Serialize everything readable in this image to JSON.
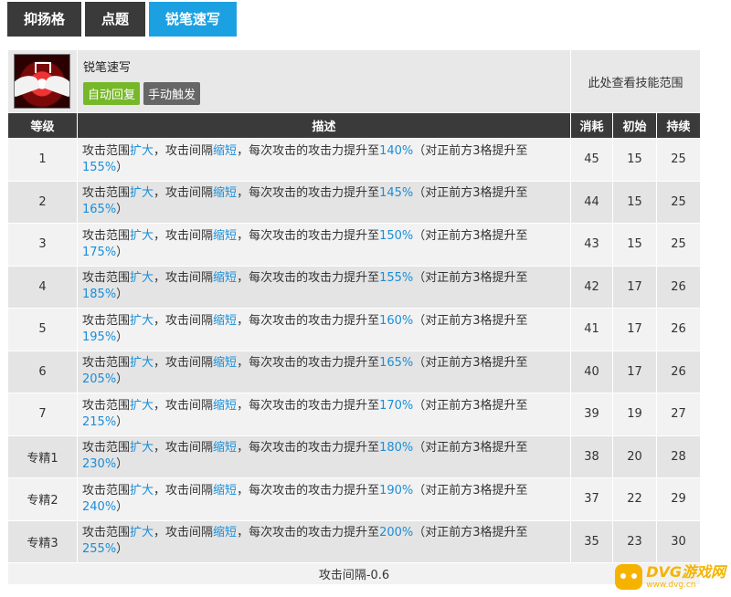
{
  "tabs": [
    {
      "label": "抑扬格",
      "active": false
    },
    {
      "label": "点题",
      "active": false
    },
    {
      "label": "锐笔速写",
      "active": true
    }
  ],
  "skill": {
    "name": "锐笔速写",
    "badges": [
      "自动回复",
      "手动触发"
    ],
    "range_text": "此处查看技能范围",
    "icon": "skill-emblem-icon"
  },
  "columns": [
    "等级",
    "描述",
    "消耗",
    "初始",
    "持续"
  ],
  "rows": [
    {
      "level": "1",
      "p1": "攻击范围",
      "h1": "扩大",
      "p2": "，攻击间隔",
      "h2": "缩短",
      "p3": "，每次攻击的攻击力提升至",
      "h3": "140%",
      "p4": "（对正前方3格提升至",
      "h4": "155%",
      "p5": "）",
      "cost": "45",
      "init": "15",
      "dur": "25"
    },
    {
      "level": "2",
      "p1": "攻击范围",
      "h1": "扩大",
      "p2": "，攻击间隔",
      "h2": "缩短",
      "p3": "，每次攻击的攻击力提升至",
      "h3": "145%",
      "p4": "（对正前方3格提升至",
      "h4": "165%",
      "p5": "）",
      "cost": "44",
      "init": "15",
      "dur": "25"
    },
    {
      "level": "3",
      "p1": "攻击范围",
      "h1": "扩大",
      "p2": "，攻击间隔",
      "h2": "缩短",
      "p3": "，每次攻击的攻击力提升至",
      "h3": "150%",
      "p4": "（对正前方3格提升至",
      "h4": "175%",
      "p5": "）",
      "cost": "43",
      "init": "15",
      "dur": "25"
    },
    {
      "level": "4",
      "p1": "攻击范围",
      "h1": "扩大",
      "p2": "，攻击间隔",
      "h2": "缩短",
      "p3": "，每次攻击的攻击力提升至",
      "h3": "155%",
      "p4": "（对正前方3格提升至",
      "h4": "185%",
      "p5": "）",
      "cost": "42",
      "init": "17",
      "dur": "26"
    },
    {
      "level": "5",
      "p1": "攻击范围",
      "h1": "扩大",
      "p2": "，攻击间隔",
      "h2": "缩短",
      "p3": "，每次攻击的攻击力提升至",
      "h3": "160%",
      "p4": "（对正前方3格提升至",
      "h4": "195%",
      "p5": "）",
      "cost": "41",
      "init": "17",
      "dur": "26"
    },
    {
      "level": "6",
      "p1": "攻击范围",
      "h1": "扩大",
      "p2": "，攻击间隔",
      "h2": "缩短",
      "p3": "，每次攻击的攻击力提升至",
      "h3": "165%",
      "p4": "（对正前方3格提升至",
      "h4": "205%",
      "p5": "）",
      "cost": "40",
      "init": "17",
      "dur": "26"
    },
    {
      "level": "7",
      "p1": "攻击范围",
      "h1": "扩大",
      "p2": "，攻击间隔",
      "h2": "缩短",
      "p3": "，每次攻击的攻击力提升至",
      "h3": "170%",
      "p4": "（对正前方3格提升至",
      "h4": "215%",
      "p5": "）",
      "cost": "39",
      "init": "19",
      "dur": "27"
    },
    {
      "level": "专精1",
      "p1": "攻击范围",
      "h1": "扩大",
      "p2": "，攻击间隔",
      "h2": "缩短",
      "p3": "，每次攻击的攻击力提升至",
      "h3": "180%",
      "p4": "（对正前方3格提升至",
      "h4": "230%",
      "p5": "）",
      "cost": "38",
      "init": "20",
      "dur": "28"
    },
    {
      "level": "专精2",
      "p1": "攻击范围",
      "h1": "扩大",
      "p2": "，攻击间隔",
      "h2": "缩短",
      "p3": "，每次攻击的攻击力提升至",
      "h3": "190%",
      "p4": "（对正前方3格提升至",
      "h4": "240%",
      "p5": "）",
      "cost": "37",
      "init": "22",
      "dur": "29"
    },
    {
      "level": "专精3",
      "p1": "攻击范围",
      "h1": "扩大",
      "p2": "，攻击间隔",
      "h2": "缩短",
      "p3": "，每次攻击的攻击力提升至",
      "h3": "200%",
      "p4": "（对正前方3格提升至",
      "h4": "255%",
      "p5": "）",
      "cost": "35",
      "init": "23",
      "dur": "30"
    }
  ],
  "footer": "攻击间隔-0.6",
  "watermark": {
    "main": "DVG游戏网",
    "sub": "www.dvg.cn"
  },
  "colors": {
    "tab_active": "#1ba1e2",
    "tab": "#3a3a3a",
    "highlight": "#1a8ed8",
    "badge_auto": "#77b82a",
    "badge_manual": "#666666"
  }
}
